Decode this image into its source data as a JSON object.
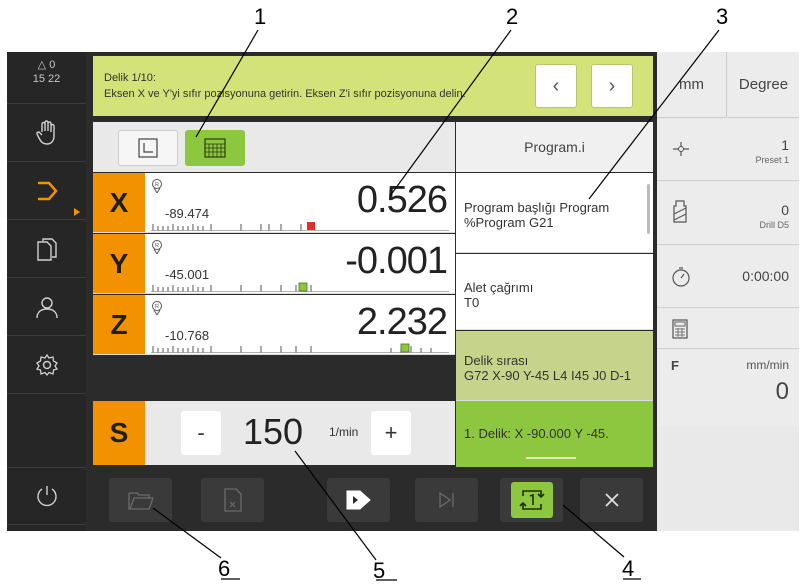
{
  "callouts": [
    "1",
    "2",
    "3",
    "4",
    "5",
    "6"
  ],
  "status": {
    "warnings": "0",
    "time": "15 22"
  },
  "message": {
    "line1": "Delik 1/10:",
    "line2": "Eksen X ve Y'yi sıfır pozisyonuna getirin. Eksen Z'i sıfır pozisyonuna delin."
  },
  "program": {
    "title": "Program.i",
    "items": [
      {
        "line1": "Program başlığı Program",
        "line2": "%Program G21"
      },
      {
        "line1": "Alet çağrımı",
        "line2": "T0"
      },
      {
        "line1": "Delik sırası",
        "line2": "G72 X-90 Y-45 L4 I45 J0 D-1"
      },
      {
        "line1": "1. Delik:   X -90.000   Y -45."
      }
    ]
  },
  "axes": [
    {
      "name": "X",
      "ref": "-89.474",
      "value": "0.526"
    },
    {
      "name": "Y",
      "ref": "-45.001",
      "value": "-0.001"
    },
    {
      "name": "Z",
      "ref": "-10.768",
      "value": "2.232"
    }
  ],
  "spindle": {
    "name": "S",
    "minus": "-",
    "value": "150",
    "unit": "1/min",
    "plus": "+"
  },
  "right": {
    "unit_length": "mm",
    "unit_angle": "Degree",
    "preset_value": "1",
    "preset_label": "Preset 1",
    "tool_value": "0",
    "tool_label": "Drill D5",
    "timer": "0:00:00",
    "feed_label": "F",
    "feed_unit": "mm/min",
    "feed_value": "0"
  },
  "colors": {
    "axis_orange": "#f39200",
    "highlight_green": "#8dc63f",
    "message_bg": "#d4e27a"
  }
}
